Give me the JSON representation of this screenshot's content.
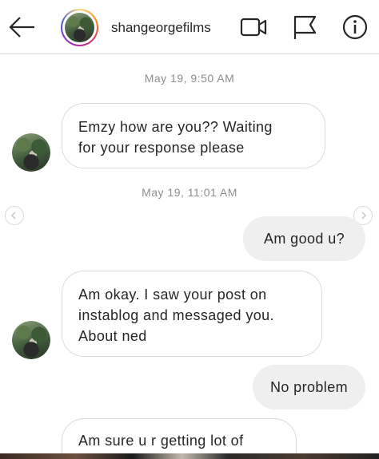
{
  "header": {
    "username": "shangeorgefilms",
    "back_icon": "arrow-left-icon",
    "video_icon": "video-camera-icon",
    "flag_icon": "flag-icon",
    "info_icon": "info-icon"
  },
  "messages": {
    "ts1": "May 19, 9:50 AM",
    "m1": "Emzy how are you?? Waiting\nfor your response please",
    "ts2": "May 19, 11:01 AM",
    "m2": "Am good u?",
    "m3": "Am okay. I saw your post on\ninstablog and messaged you.\nAbout ned",
    "m4": "No problem",
    "m5": "Am sure u r getting lot of"
  }
}
